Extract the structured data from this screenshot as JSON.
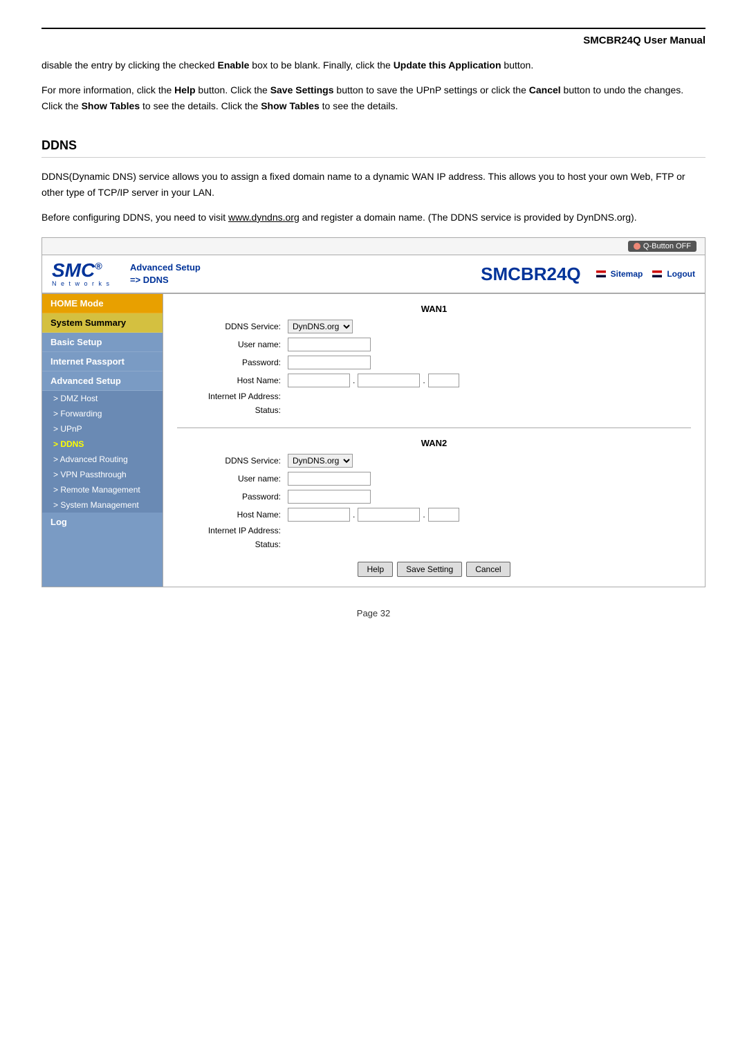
{
  "page": {
    "title": "SMCBR24Q User Manual",
    "footer": "Page 32"
  },
  "intro": {
    "para1": "disable the entry by clicking the checked Enable box to be blank. Finally, click the Update this Application button.",
    "para2": "For more information, click the Help button. Click the Save Settings button to save the UPnP settings or click the Cancel button to undo the changes. Click the Show Tables to see the details. Click the Show Tables to see the details."
  },
  "ddns": {
    "heading": "DDNS",
    "para1": "DDNS(Dynamic DNS) service allows you to assign a fixed domain name to a dynamic WAN IP address. This allows you to host your own Web, FTP or other type of TCP/IP server in your LAN.",
    "para2_before": "Before configuring DDNS, you need to visit ",
    "para2_link": "www.dyndns.org",
    "para2_after": " and register a domain name. (The DDNS service is provided by DynDNS.org)."
  },
  "router_ui": {
    "q_button": "Q-Button OFF",
    "logo": "SMC",
    "networks": "N e t w o r k s",
    "breadcrumb_line1": "Advanced Setup",
    "breadcrumb_line2": "=> DDNS",
    "model": "SMCBR24Q",
    "sitemap": "Sitemap",
    "logout": "Logout"
  },
  "sidebar": {
    "home_mode": "HOME Mode",
    "system_summary": "System Summary",
    "basic_setup": "Basic Setup",
    "internet_passport": "Internet Passport",
    "advanced_setup": "Advanced Setup",
    "sub_items": [
      "> DMZ Host",
      "> Forwarding",
      "> UPnP",
      "> DDNS",
      "> Advanced Routing",
      "> VPN Passthrough",
      "> Remote Management",
      "> System Management"
    ],
    "log": "Log"
  },
  "form": {
    "wan1_title": "WAN1",
    "wan2_title": "WAN2",
    "ddns_service_label": "DDNS Service:",
    "user_name_label": "User name:",
    "password_label": "Password:",
    "host_name_label": "Host Name:",
    "internet_ip_label": "Internet IP Address:",
    "status_label": "Status:",
    "ddns_service_option": "DynDNS.org",
    "buttons": {
      "help": "Help",
      "save_setting": "Save Setting",
      "cancel": "Cancel"
    }
  }
}
